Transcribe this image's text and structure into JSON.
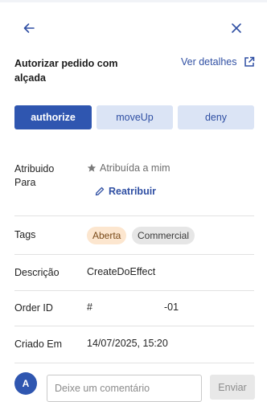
{
  "header": {
    "back_icon": "arrow-left-icon",
    "close_icon": "close-icon",
    "title": "Autorizar pedido com alçada",
    "details_link": "Ver detalhes",
    "details_icon": "external-link-icon"
  },
  "actions": [
    {
      "label": "authorize",
      "primary": true
    },
    {
      "label": "moveUp",
      "primary": false
    },
    {
      "label": "deny",
      "primary": false
    }
  ],
  "fields": {
    "assigned": {
      "label": "Atribuido Para",
      "value": "Atribuída a mim",
      "value_icon": "star-icon",
      "reassign_label": "Reatribuir",
      "reassign_icon": "pencil-icon"
    },
    "tags": {
      "label": "Tags",
      "items": [
        "Aberta",
        "Commercial"
      ]
    },
    "description": {
      "label": "Descrição",
      "value": "CreateDoEffect"
    },
    "order_id": {
      "label": "Order ID",
      "prefix": "#",
      "suffix": "-01"
    },
    "created": {
      "label": "Criado Em",
      "value": "14/07/2025, 15:20"
    }
  },
  "comment": {
    "avatar_initial": "A",
    "placeholder": "Deixe um comentário",
    "send_label": "Enviar"
  },
  "colors": {
    "primary": "#2f56b0",
    "primary_light": "#dbe4f5",
    "link": "#2f4fa3",
    "tag_open_bg": "#fce6cf",
    "tag_neutral_bg": "#e6e6e6",
    "divider": "#e2e2e2"
  }
}
